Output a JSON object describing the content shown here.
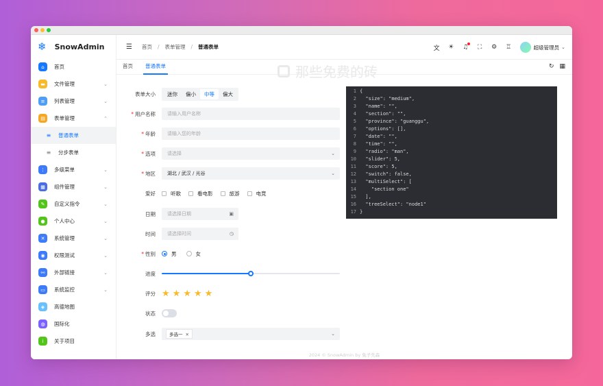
{
  "app": {
    "name": "SnowAdmin"
  },
  "sidebar": {
    "items": [
      {
        "label": "首页",
        "icon": "home-icon",
        "color": "#1677ff",
        "glyph": "⌂",
        "chev": ""
      },
      {
        "label": "文件管理",
        "icon": "folder-icon",
        "color": "#f7ba2a",
        "glyph": "▬",
        "chev": "⌄"
      },
      {
        "label": "列表管理",
        "icon": "list-icon",
        "color": "#4e9ef5",
        "glyph": "≡",
        "chev": "⌄"
      },
      {
        "label": "表单管理",
        "icon": "form-icon",
        "color": "#f5a623",
        "glyph": "▤",
        "chev": "⌃"
      },
      {
        "label": "普通表单",
        "icon": "menu-lines-icon",
        "glyph": "≡",
        "sub": true,
        "active": true
      },
      {
        "label": "分步表单",
        "icon": "menu-lines-icon",
        "glyph": "≡",
        "sub": true
      },
      {
        "label": "多级菜单",
        "icon": "tree-icon",
        "color": "#3e7bfa",
        "glyph": "⋮",
        "chev": "⌄"
      },
      {
        "label": "组件管理",
        "icon": "grid-icon",
        "color": "#4a6ee0",
        "glyph": "▦",
        "chev": "⌄"
      },
      {
        "label": "自定义指令",
        "icon": "leaf-icon",
        "color": "#52c41a",
        "glyph": "✎",
        "chev": "⌄"
      },
      {
        "label": "个人中心",
        "icon": "user-icon",
        "color": "#52c41a",
        "glyph": "●",
        "chev": "⌄"
      },
      {
        "label": "系统管理",
        "icon": "tools-icon",
        "color": "#3e7bfa",
        "glyph": "✕",
        "chev": "⌄"
      },
      {
        "label": "权限测试",
        "icon": "lock-icon",
        "color": "#3e7bfa",
        "glyph": "◉",
        "chev": "⌄"
      },
      {
        "label": "外部链接",
        "icon": "link-icon",
        "color": "#3e7bfa",
        "glyph": "⚯",
        "chev": "⌄"
      },
      {
        "label": "系统监控",
        "icon": "monitor-icon",
        "color": "#3e7bfa",
        "glyph": "▭",
        "chev": "⌄"
      },
      {
        "label": "高德地图",
        "icon": "map-icon",
        "color": "#69c0ff",
        "glyph": "◈",
        "chev": ""
      },
      {
        "label": "国际化",
        "icon": "globe-icon",
        "color": "#7b61ff",
        "glyph": "◍",
        "chev": ""
      },
      {
        "label": "关于项目",
        "icon": "info-icon",
        "color": "#52c41a",
        "glyph": "i",
        "chev": ""
      }
    ]
  },
  "header": {
    "breadcrumb": [
      "首页",
      "表单管理",
      "普通表单"
    ],
    "user": "超级管理员"
  },
  "tabs": [
    {
      "label": "首页",
      "active": false
    },
    {
      "label": "普通表单",
      "active": true
    }
  ],
  "watermark": "那些免费的砖",
  "form": {
    "size_label": "表单大小",
    "sizes": [
      "迷你",
      "偏小",
      "中等",
      "偏大"
    ],
    "size_selected": "中等",
    "username_label": "用户名称",
    "username_placeholder": "请输入用户名称",
    "age_label": "年龄",
    "age_placeholder": "请输入您的年龄",
    "section_label": "选项",
    "section_placeholder": "请选择",
    "region_label": "地区",
    "region_value": "湖北 / 武汉 / 光谷",
    "hobby_label": "爱好",
    "hobbies": [
      "听歌",
      "看电影",
      "旅游",
      "电竞"
    ],
    "date_label": "日期",
    "date_placeholder": "请选择日期",
    "time_label": "时间",
    "time_placeholder": "请选择时间",
    "gender_label": "性别",
    "gender_options": [
      "男",
      "女"
    ],
    "gender_selected": "男",
    "progress_label": "进度",
    "progress_fraction": 0.5,
    "score_label": "评分",
    "score": 5,
    "status_label": "状态",
    "status_on": false,
    "multi_label": "多选",
    "multi_tag": "多选一"
  },
  "code_lines": [
    "{",
    "  \"size\": \"medium\",",
    "  \"name\": \"\",",
    "  \"section\": \"\",",
    "  \"province\": \"guanggu\",",
    "  \"options\": [],",
    "  \"date\": \"\",",
    "  \"time\": \"\",",
    "  \"radio\": \"man\",",
    "  \"slider\": 5,",
    "  \"score\": 5,",
    "  \"switch\": false,",
    "  \"multiSelect\": [",
    "    \"section one\"",
    "  ],",
    "  \"treeSelect\": \"node1\"",
    "}"
  ],
  "footer": "2024 © SnowAdmin by 兔子先森",
  "colors": {
    "primary": "#1677ff",
    "required": "#f5222d",
    "star": "#f7ba2a"
  }
}
